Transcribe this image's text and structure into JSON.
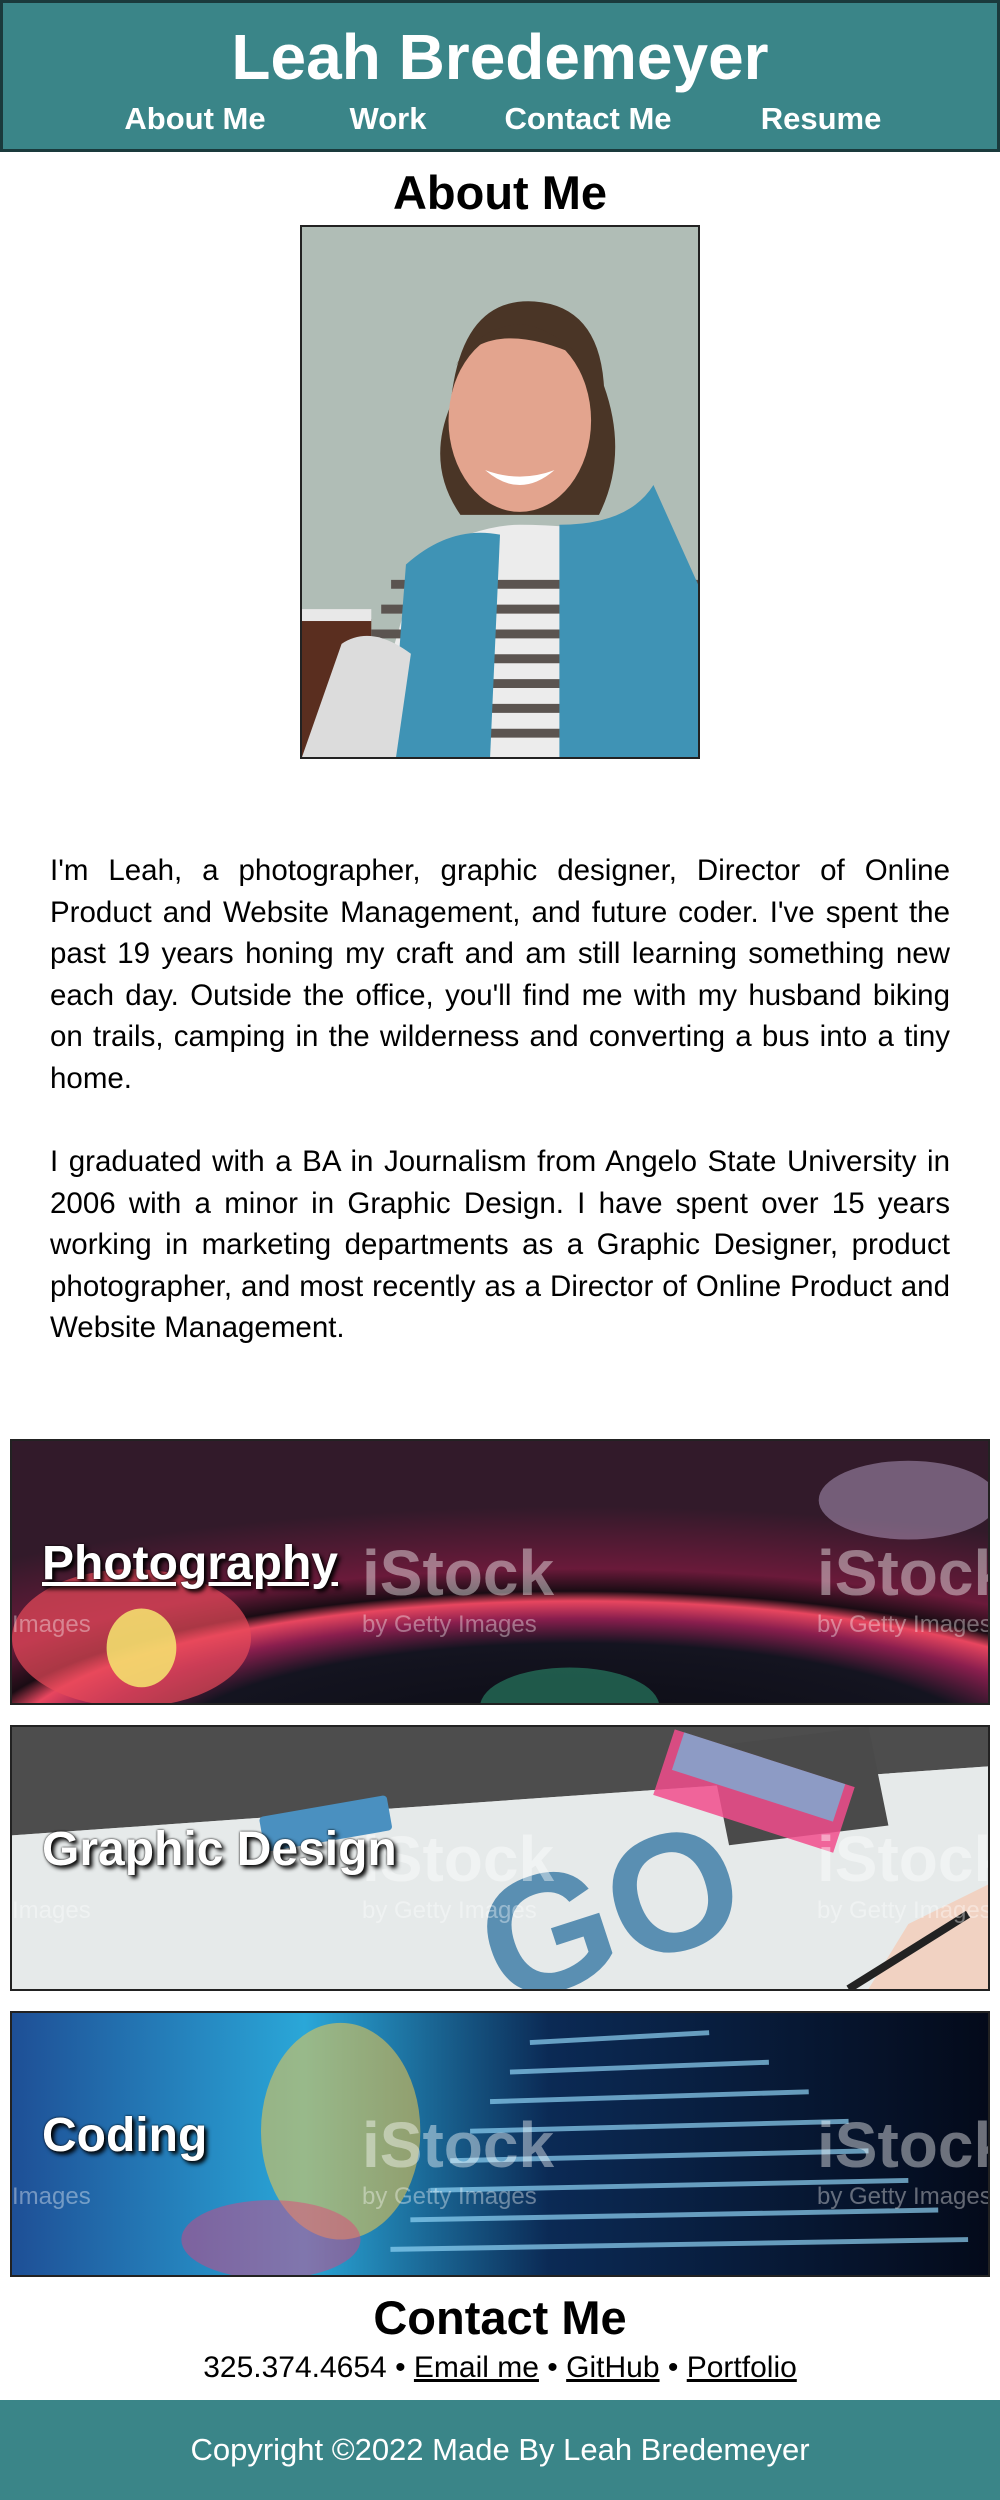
{
  "header": {
    "title": "Leah Bredemeyer",
    "nav": [
      "About Me",
      "Work",
      "Contact Me",
      "Resume"
    ]
  },
  "about": {
    "heading": "About Me",
    "paragraphs": [
      "I'm Leah, a photographer, graphic designer, Director of Online Product and Website Management, and future coder. I've spent the past 19 years honing my craft and am still learning something new each day. Outside the office, you'll find me with my husband biking on trails, camping in the wilderness and converting a bus into a tiny home.",
      "I graduated with a BA in Journalism from Angelo State University in 2006 with a minor in Graphic Design. I have spent over 15 years working in marketing departments as a Graphic Designer, product photographer, and most recently as a Director of Online Product and Website Management."
    ]
  },
  "work": {
    "tiles": [
      {
        "label": "Photography"
      },
      {
        "label": "Graphic Design"
      },
      {
        "label": "Coding"
      }
    ],
    "watermark": "iStock",
    "watermark_sub": "by Getty Images",
    "watermark_edge": "Images"
  },
  "contact": {
    "heading": "Contact Me",
    "phone": "325.374.4654",
    "separator": "•",
    "links": [
      "Email me",
      "GitHub",
      "Portfolio"
    ]
  },
  "footer": {
    "text": "Copyright ©2022 Made By Leah Bredemeyer"
  },
  "colors": {
    "header_bg": "#3a8588",
    "header_border": "#1a3a3c",
    "footer_bg": "#3a8588",
    "text": "#000000"
  }
}
